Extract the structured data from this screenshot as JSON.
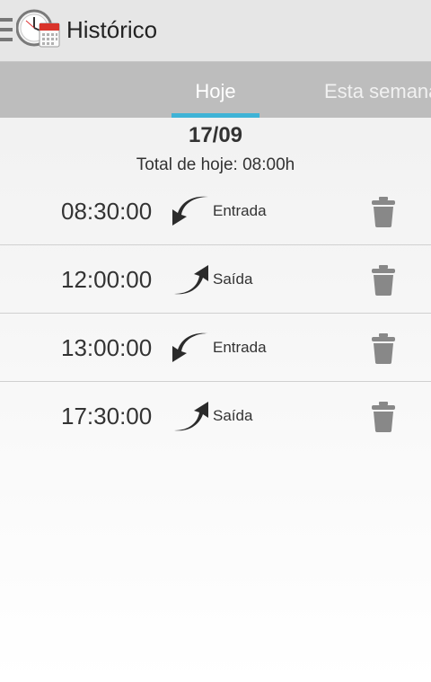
{
  "app": {
    "title": "Histórico"
  },
  "tabs": [
    {
      "label": "Hoje",
      "selected": true
    },
    {
      "label": "Esta semana",
      "selected": false
    }
  ],
  "day": {
    "date": "17/09",
    "total": "Total de hoje: 08:00h"
  },
  "entries": [
    {
      "time": "08:30:00",
      "type": "Entrada",
      "icon": "arrow-entrada-icon"
    },
    {
      "time": "12:00:00",
      "type": "Saída",
      "icon": "arrow-saida-icon"
    },
    {
      "time": "13:00:00",
      "type": "Entrada",
      "icon": "arrow-entrada-icon"
    },
    {
      "time": "17:30:00",
      "type": "Saída",
      "icon": "arrow-saida-icon"
    }
  ],
  "colors": {
    "tab_indicator": "#3fb3d6",
    "tab_bar": "#bdbdbd",
    "action_bar": "#e6e6e6"
  }
}
